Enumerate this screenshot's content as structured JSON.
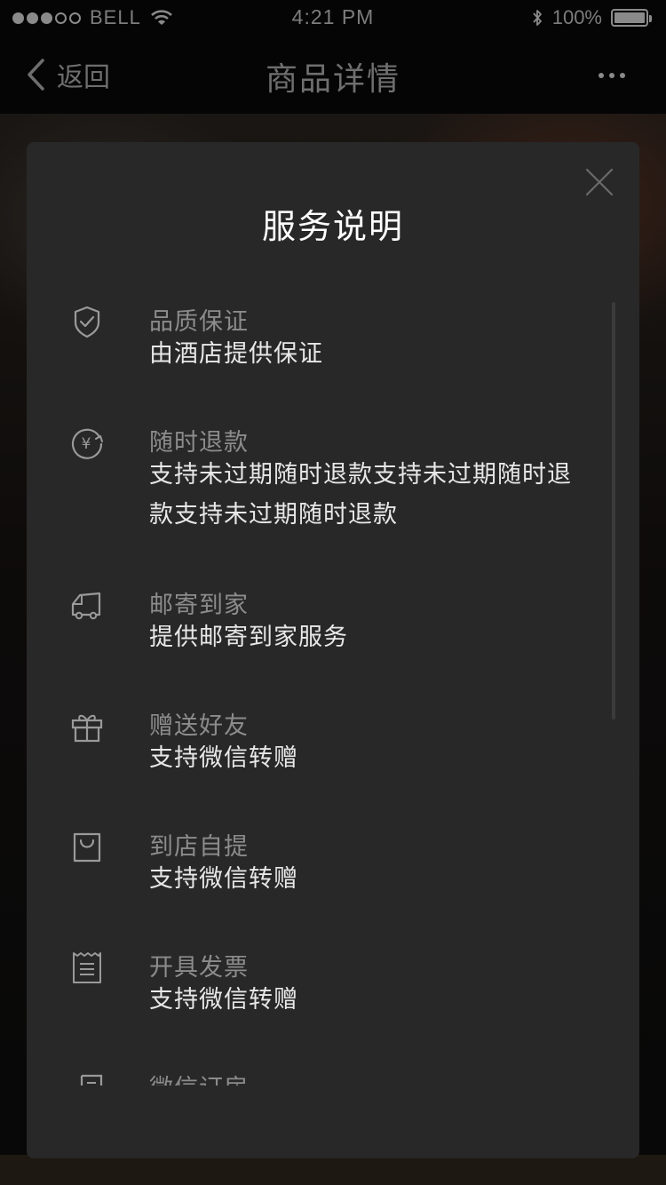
{
  "status_bar": {
    "carrier": "BELL",
    "time": "4:21 PM",
    "battery": "100%",
    "signal_icon": "signal-dots-icon",
    "wifi_icon": "wifi-icon",
    "bluetooth_icon": "bluetooth-icon",
    "battery_icon": "battery-icon",
    "battery_level": 1.0
  },
  "nav": {
    "back_label": "返回",
    "title": "商品详情",
    "back_icon": "chevron-left-icon",
    "more_icon": "more-icon"
  },
  "modal": {
    "title": "服务说明",
    "close_icon": "close-icon",
    "items": [
      {
        "icon": "shield-check-icon",
        "title": "品质保证",
        "desc": "由酒店提供保证"
      },
      {
        "icon": "refund-yen-icon",
        "title": "随时退款",
        "desc": "支持未过期随时退款支持未过期随时退款支持未过期随时退款"
      },
      {
        "icon": "truck-icon",
        "title": "邮寄到家",
        "desc": "提供邮寄到家服务"
      },
      {
        "icon": "gift-icon",
        "title": "赠送好友",
        "desc": "支持微信转赠"
      },
      {
        "icon": "shopping-bag-icon",
        "title": "到店自提",
        "desc": "支持微信转赠"
      },
      {
        "icon": "receipt-icon",
        "title": "开具发票",
        "desc": "支持微信转赠"
      },
      {
        "icon": "room-booking-icon",
        "title": "微信订房",
        "desc": ""
      }
    ]
  },
  "colors": {
    "modal_background": "#282828",
    "title_text": "#ffffff",
    "item_title_text": "#8c8c8c",
    "item_desc_text": "#e8e8e8",
    "icon_stroke": "#9a9a9a"
  }
}
